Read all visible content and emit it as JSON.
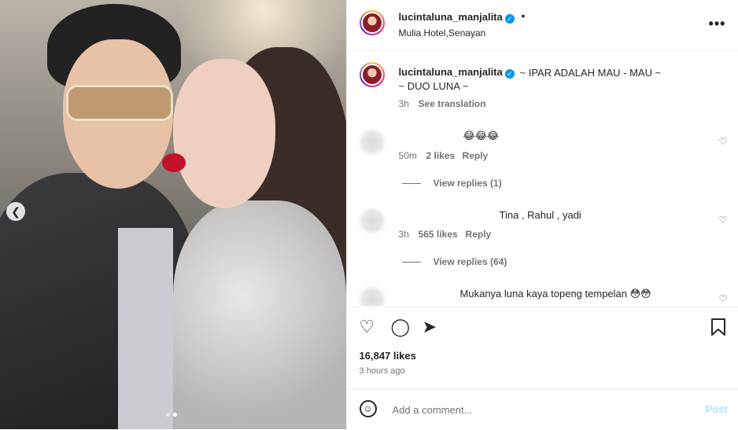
{
  "post": {
    "username": "lucintaluna_manjalita",
    "verified_mark": "✓",
    "separator": "•",
    "location": "Mulia Hotel,Senayan",
    "more_icon": "more-horizontal-icon",
    "more_label": "•••",
    "caption_line1": "~ IPAR ADALAH MAU - MAU ~",
    "caption_line2": "~ DUO LUNA ~",
    "caption_time": "3h",
    "see_translation": "See translation",
    "photo_dots": 2,
    "active_dot": 1
  },
  "comments": [
    {
      "text": "😂😂😂",
      "time": "50m",
      "likes": "2 likes",
      "reply": "Reply",
      "view_replies": "View replies (1)"
    },
    {
      "text": "Tina , Rahul , yadi",
      "time": "3h",
      "likes": "565 likes",
      "reply": "Reply",
      "view_replies": "View replies (64)"
    },
    {
      "text": "Mukanya luna kaya topeng tempelan 😳😳"
    }
  ],
  "actions": {
    "like_icon": "heart-icon",
    "comment_icon": "comment-icon",
    "share_icon": "send-icon",
    "save_icon": "bookmark-icon"
  },
  "stats": {
    "likes": "16,847 likes",
    "time": "3 hours ago"
  },
  "comment_box": {
    "placeholder": "Add a comment...",
    "post_label": "Post",
    "emoji_icon": "smiley-icon"
  },
  "colors": {
    "accent": "#0095f6",
    "post_disabled": "#b2dffc",
    "secondary_text": "#737373"
  }
}
